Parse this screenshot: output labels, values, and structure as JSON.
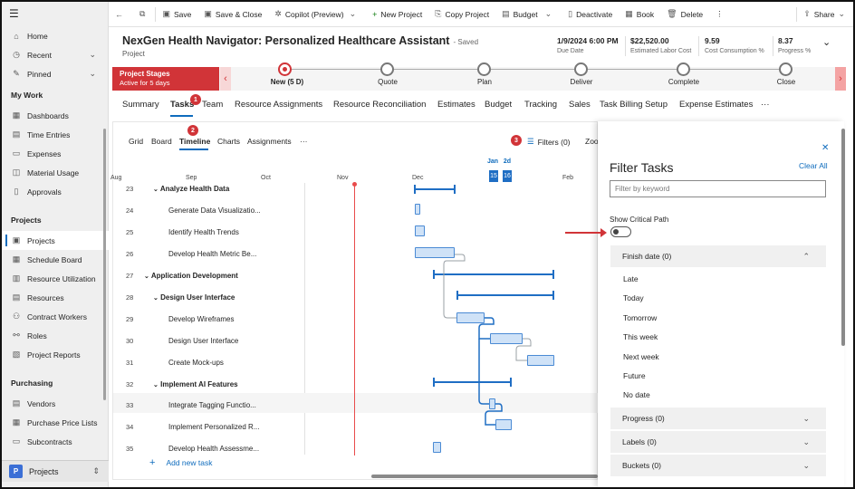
{
  "command_bar": {
    "save": "Save",
    "save_close": "Save & Close",
    "copilot": "Copilot (Preview)",
    "new_project": "New Project",
    "copy_project": "Copy Project",
    "budget": "Budget",
    "deactivate": "Deactivate",
    "book": "Book",
    "delete": "Delete",
    "share": "Share"
  },
  "sidebar": {
    "items_top": [
      {
        "label": "Home",
        "icon": "home-icon"
      },
      {
        "label": "Recent",
        "icon": "clock-icon"
      },
      {
        "label": "Pinned",
        "icon": "pin-icon"
      }
    ],
    "sections": [
      {
        "title": "My Work",
        "items": [
          "Dashboards",
          "Time Entries",
          "Expenses",
          "Material Usage",
          "Approvals"
        ]
      },
      {
        "title": "Projects",
        "items": [
          "Projects",
          "Schedule Board",
          "Resource Utilization",
          "Resources",
          "Contract Workers",
          "Roles",
          "Project Reports"
        ]
      },
      {
        "title": "Purchasing",
        "items": [
          "Vendors",
          "Purchase Price Lists",
          "Subcontracts"
        ]
      }
    ],
    "area_initial": "P",
    "area_label": "Projects"
  },
  "record": {
    "title": "NexGen Health Navigator: Personalized Healthcare Assistant",
    "saved": "- Saved",
    "type": "Project",
    "fields": [
      {
        "value": "1/9/2024 6:00 PM",
        "label": "Due Date"
      },
      {
        "value": "$22,520.00",
        "label": "Estimated Labor Cost"
      },
      {
        "value": "9.59",
        "label": "Cost Consumption %"
      },
      {
        "value": "8.37",
        "label": "Progress %"
      }
    ]
  },
  "stages": {
    "active_title": "Project Stages",
    "active_sub": "Active for 5 days",
    "items": [
      "New  (5 D)",
      "Quote",
      "Plan",
      "Deliver",
      "Complete",
      "Close"
    ]
  },
  "tabs": [
    "Summary",
    "Tasks",
    "Team",
    "Resource Assignments",
    "Resource Reconciliation",
    "Estimates",
    "Budget",
    "Tracking",
    "Sales",
    "Task Billing Setup",
    "Expense Estimates",
    "···"
  ],
  "badges": {
    "one": "1",
    "two": "2",
    "three": "3"
  },
  "view_tabs": [
    "Grid",
    "Board",
    "Timeline",
    "Charts",
    "Assignments",
    "···"
  ],
  "filters_label": "Filters (0)",
  "zoom_label": "Zoo",
  "timeline": {
    "months": [
      "Aug",
      "Sep",
      "Oct",
      "Nov",
      "Dec",
      "Jan",
      "Feb"
    ],
    "jan_label": "Jan",
    "jan_week": "2d",
    "days": [
      "15",
      "16"
    ]
  },
  "task_rows": [
    {
      "n": "23",
      "name": "Analyze Health Data",
      "level": 1
    },
    {
      "n": "24",
      "name": "Generate Data Visualizatio...",
      "level": 2
    },
    {
      "n": "25",
      "name": "Identify Health Trends",
      "level": 2
    },
    {
      "n": "26",
      "name": "Develop Health Metric Be...",
      "level": 2
    },
    {
      "n": "27",
      "name": "Application Development",
      "level": 0
    },
    {
      "n": "28",
      "name": "Design User Interface",
      "level": 1
    },
    {
      "n": "29",
      "name": "Develop Wireframes",
      "level": 2
    },
    {
      "n": "30",
      "name": "Design User Interface",
      "level": 2
    },
    {
      "n": "31",
      "name": "Create Mock-ups",
      "level": 2
    },
    {
      "n": "32",
      "name": "Implement AI Features",
      "level": 1
    },
    {
      "n": "33",
      "name": "Integrate Tagging Functio...",
      "level": 2
    },
    {
      "n": "34",
      "name": "Implement Personalized R...",
      "level": 2
    },
    {
      "n": "35",
      "name": "Develop Health Assessme...",
      "level": 2
    }
  ],
  "add_task": "Add new task",
  "filter_panel": {
    "title": "Filter Tasks",
    "clear_all": "Clear All",
    "search_placeholder": "Filter by keyword",
    "critical_path": "Show Critical Path",
    "finish_date": "Finish date (0)",
    "finish_options": [
      "Late",
      "Today",
      "Tomorrow",
      "This week",
      "Next week",
      "Future",
      "No date"
    ],
    "other_sections": [
      "Progress (0)",
      "Labels (0)",
      "Buckets (0)"
    ]
  },
  "colors": {
    "accent": "#0f6cbd",
    "stage_active": "#d13438",
    "bar_fill": "#cfe2f7"
  }
}
